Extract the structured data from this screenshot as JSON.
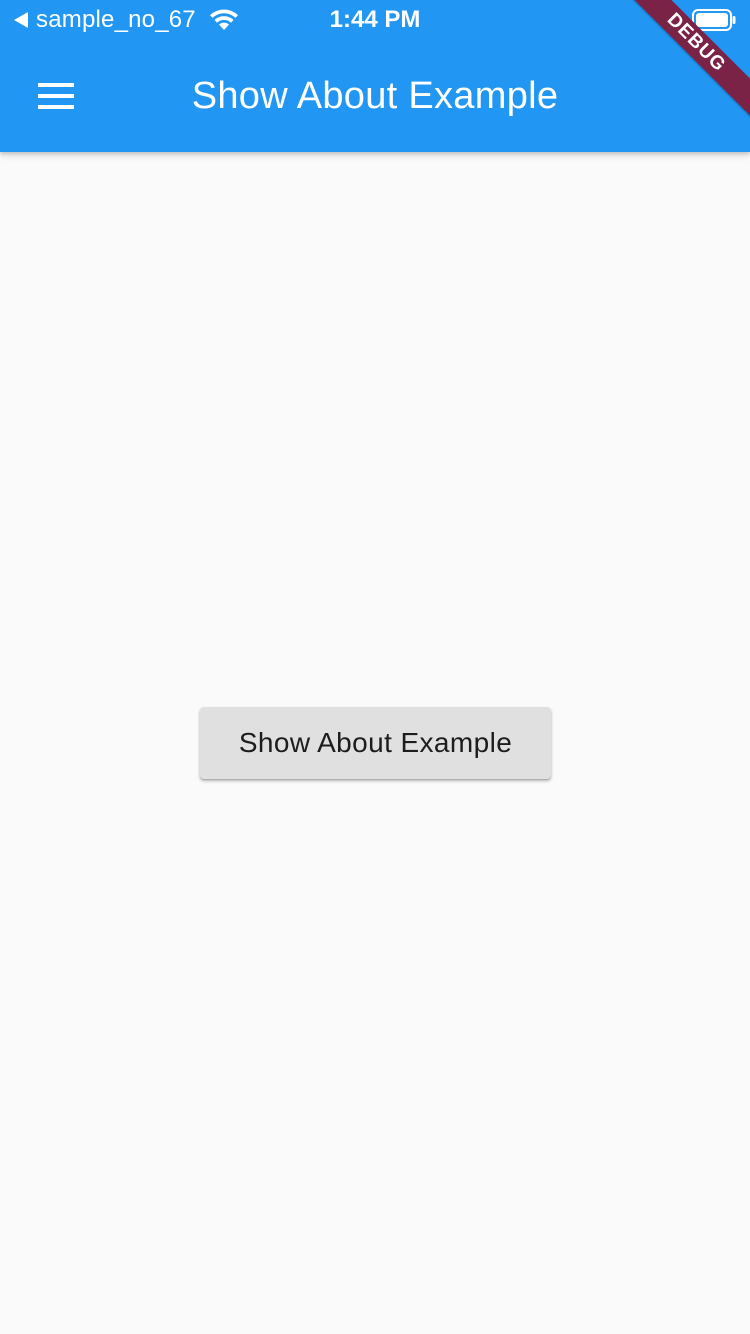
{
  "status_bar": {
    "back_app_name": "sample_no_67",
    "time": "1:44 PM",
    "wifi_icon": "wifi-icon",
    "battery_icon": "battery-icon"
  },
  "app_bar": {
    "title": "Show About Example",
    "menu_icon": "menu-icon",
    "background_color": "#2196f3"
  },
  "debug_banner": {
    "label": "DEBUG",
    "color": "#7b2347"
  },
  "main": {
    "button_label": "Show About Example"
  }
}
